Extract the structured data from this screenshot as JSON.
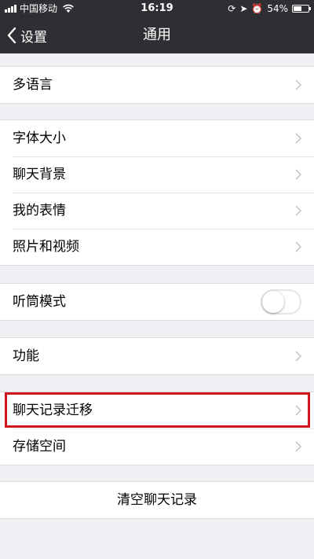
{
  "status_bar": {
    "carrier": "中国移动",
    "time": "16:19",
    "battery_percent_text": "54%",
    "battery_level": 0.54
  },
  "nav": {
    "back_label": "设置",
    "title": "通用"
  },
  "groups": {
    "language": {
      "items": [
        "多语言"
      ]
    },
    "display": {
      "items": [
        "字体大小",
        "聊天背景",
        "我的表情",
        "照片和视频"
      ]
    },
    "earpiece": {
      "label": "听筒模式",
      "enabled": false
    },
    "features": {
      "items": [
        "功能"
      ]
    },
    "storage": {
      "items": [
        "聊天记录迁移",
        "存储空间"
      ]
    },
    "clear": {
      "label": "清空聊天记录"
    }
  },
  "colors": {
    "nav_background": "#2e2e33",
    "page_background": "#efeff4",
    "highlight": "#d0161b"
  },
  "highlighted_item": "聊天记录迁移"
}
